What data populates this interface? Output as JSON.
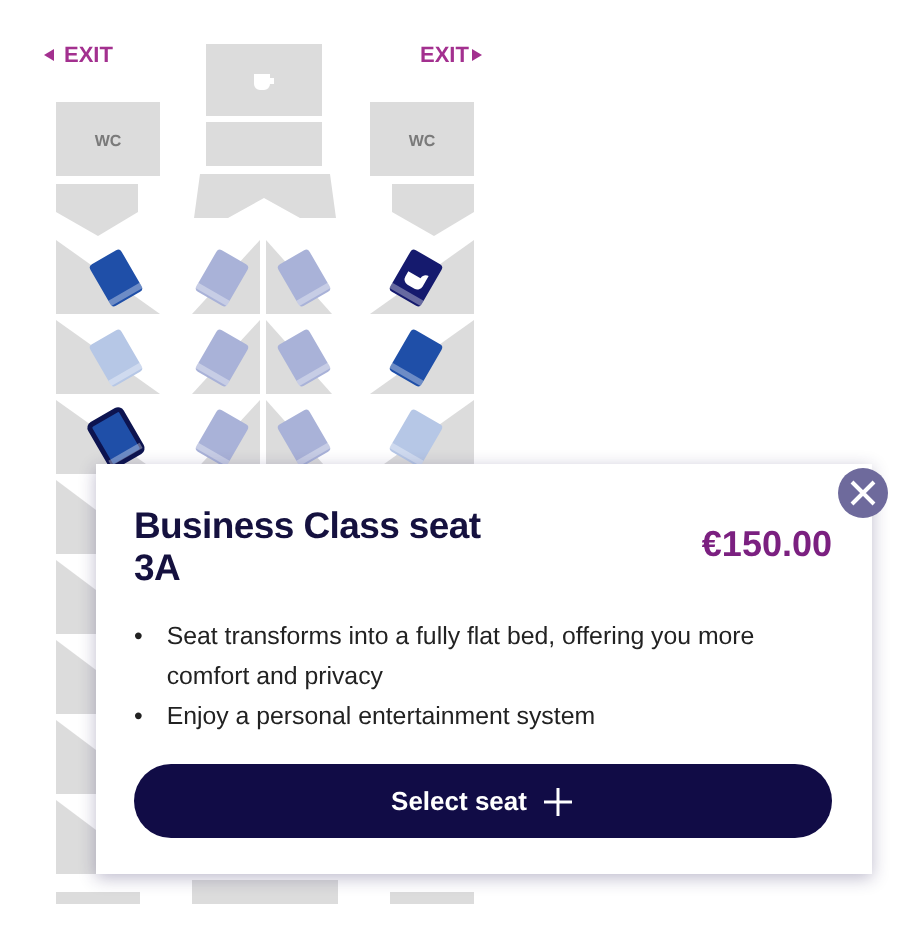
{
  "exits": [
    {
      "label": "EXIT"
    },
    {
      "label": "EXIT"
    }
  ],
  "facilities": [
    {
      "kind": "galley"
    },
    {
      "kind": "wc",
      "label": "WC"
    },
    {
      "kind": "wc",
      "label": "WC"
    }
  ],
  "rows": [
    {
      "left": {
        "color": "#1f4fa8",
        "selected": false,
        "bassinet": false
      },
      "middle_left": {
        "color": "#a9b2d8",
        "selected": false,
        "bassinet": false
      },
      "middle_right": {
        "color": "#a9b2d8",
        "selected": false,
        "bassinet": false
      },
      "right": {
        "color": "#151a6e",
        "selected": false,
        "bassinet": true
      }
    },
    {
      "left": {
        "color": "#b6c7e6",
        "selected": false,
        "bassinet": false
      },
      "middle_left": {
        "color": "#a9b2d8",
        "selected": false,
        "bassinet": false
      },
      "middle_right": {
        "color": "#a9b2d8",
        "selected": false,
        "bassinet": false
      },
      "right": {
        "color": "#1f4fa8",
        "selected": false,
        "bassinet": false
      }
    },
    {
      "left": {
        "color": "#1f4fa8",
        "selected": true,
        "bassinet": false
      },
      "middle_left": {
        "color": "#a9b2d8",
        "selected": false,
        "bassinet": false
      },
      "middle_right": {
        "color": "#a9b2d8",
        "selected": false,
        "bassinet": false
      },
      "right": {
        "color": "#b6c7e6",
        "selected": false,
        "bassinet": false
      }
    }
  ],
  "popup": {
    "title": "Business Class seat 3A",
    "price": "€150.00",
    "bullet": "•",
    "features": [
      "Seat transforms into a fully flat bed, offering you more comfort and privacy",
      "Enjoy a personal entertainment system"
    ],
    "button": "Select seat"
  }
}
